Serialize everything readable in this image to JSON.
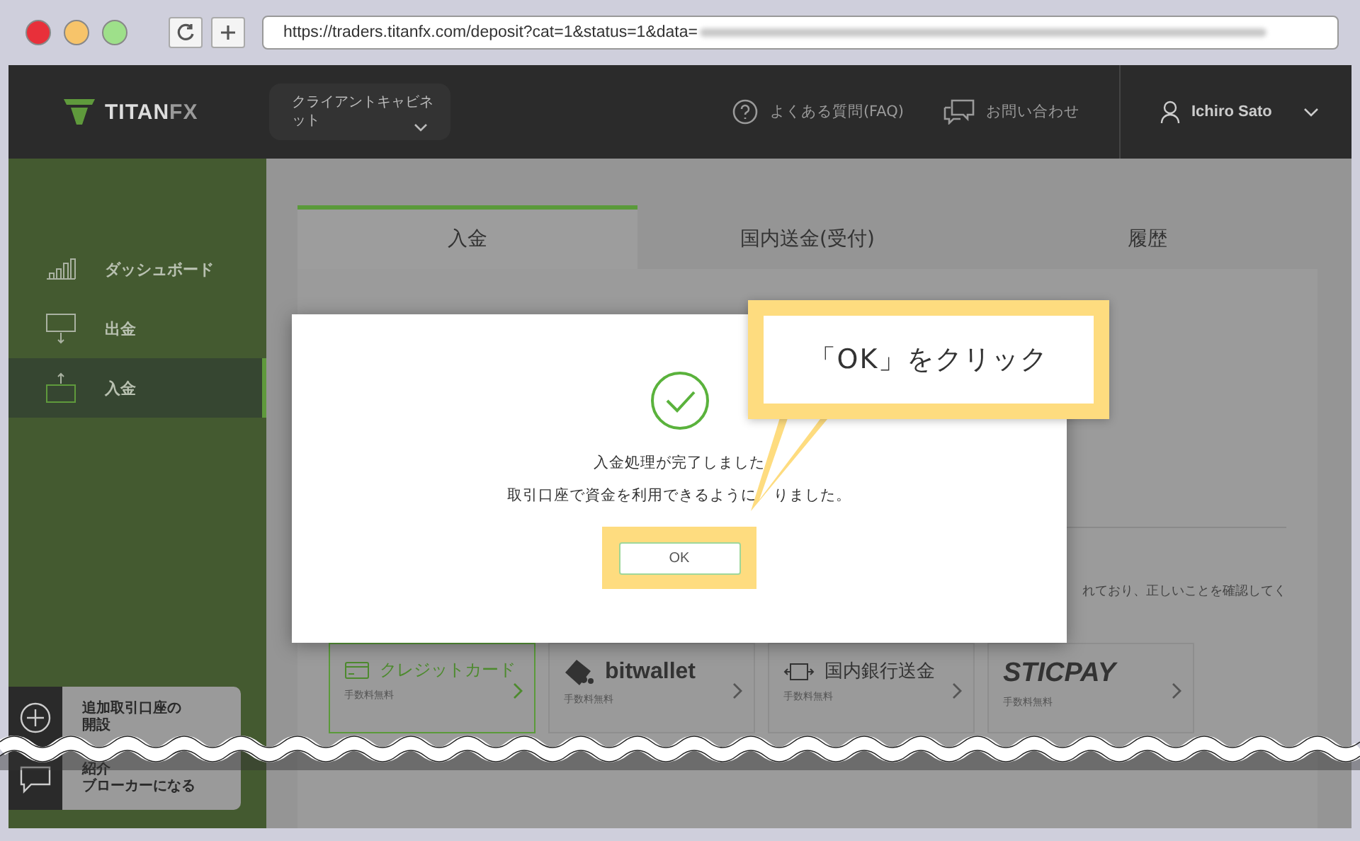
{
  "browser": {
    "url": "https://traders.titanfx.com/deposit?cat=1&status=1&data="
  },
  "header": {
    "logo": {
      "main": "TITAN",
      "accent": "FX"
    },
    "cabinet_menu": "クライアントキャビネット",
    "links": [
      {
        "label": "よくある質問(FAQ)",
        "kind": "faq"
      },
      {
        "label": "お問い合わせ",
        "kind": "contact"
      }
    ],
    "user": "Ichiro Sato"
  },
  "sidebar": {
    "items": [
      {
        "label": "ダッシュボード",
        "kind": "dashboard",
        "selected": false
      },
      {
        "label": "出金",
        "kind": "withdraw",
        "selected": false
      },
      {
        "label": "入金",
        "kind": "deposit",
        "selected": true
      }
    ],
    "actions": [
      {
        "kind": "add",
        "lines": [
          "追加取引口座の",
          "開設"
        ]
      },
      {
        "kind": "chat",
        "lines": [
          "紹介",
          "ブローカーになる"
        ]
      }
    ]
  },
  "tabs": [
    {
      "label": "入金",
      "selected": true
    },
    {
      "label": "国内送金(受付)",
      "selected": false
    },
    {
      "label": "履歴",
      "selected": false
    }
  ],
  "notice_fragment": "れており、正しいことを確認してく",
  "methods": [
    {
      "label": "クレジットカード",
      "kind": "card",
      "fee": "手数料無料",
      "selected": true
    },
    {
      "label": "bitwallet",
      "kind": "bitwallet",
      "fee": "手数料無料",
      "selected": false
    },
    {
      "label": "国内銀行送金",
      "kind": "bank",
      "fee": "手数料無料",
      "selected": false
    },
    {
      "label": "STICPAY",
      "kind": "sticpay",
      "fee": "手数料無料",
      "selected": false
    }
  ],
  "dialog": {
    "lines": [
      [
        "入金処理が完了しました"
      ],
      [
        "取引口座で資金を利用できるように",
        "りました。"
      ]
    ],
    "button": "OK"
  },
  "callout": {
    "text": "「OK」をクリック"
  }
}
